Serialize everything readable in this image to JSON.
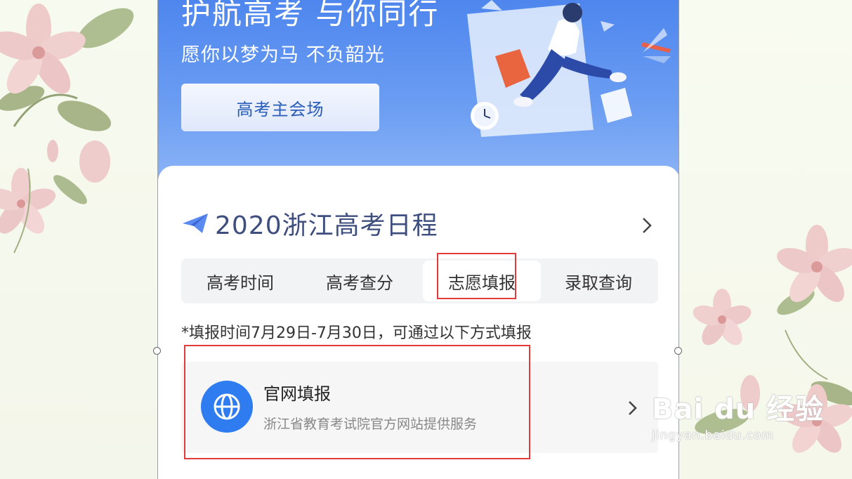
{
  "banner": {
    "title": "护航高考 与你同行",
    "subtitle": "愿你以梦为马 不负韶光",
    "main_button": "高考主会场"
  },
  "card": {
    "title": "2020浙江高考日程",
    "tabs": [
      {
        "label": "高考时间",
        "active": false
      },
      {
        "label": "高考查分",
        "active": false
      },
      {
        "label": "志愿填报",
        "active": true
      },
      {
        "label": "录取查询",
        "active": false
      }
    ],
    "note": "*填报时间7月29日-7月30日，可通过以下方式填报",
    "option": {
      "icon": "globe-icon",
      "title": "官网填报",
      "description": "浙江省教育考试院官方网站提供服务"
    }
  },
  "watermark": {
    "brand": "Bai du 经验",
    "url": "jingyan.baidu.com"
  },
  "colors": {
    "banner_blue": "#4e86ee",
    "accent_blue": "#2f7cf0",
    "title_navy": "#3e4e7e",
    "highlight_red": "#e23b3b"
  }
}
